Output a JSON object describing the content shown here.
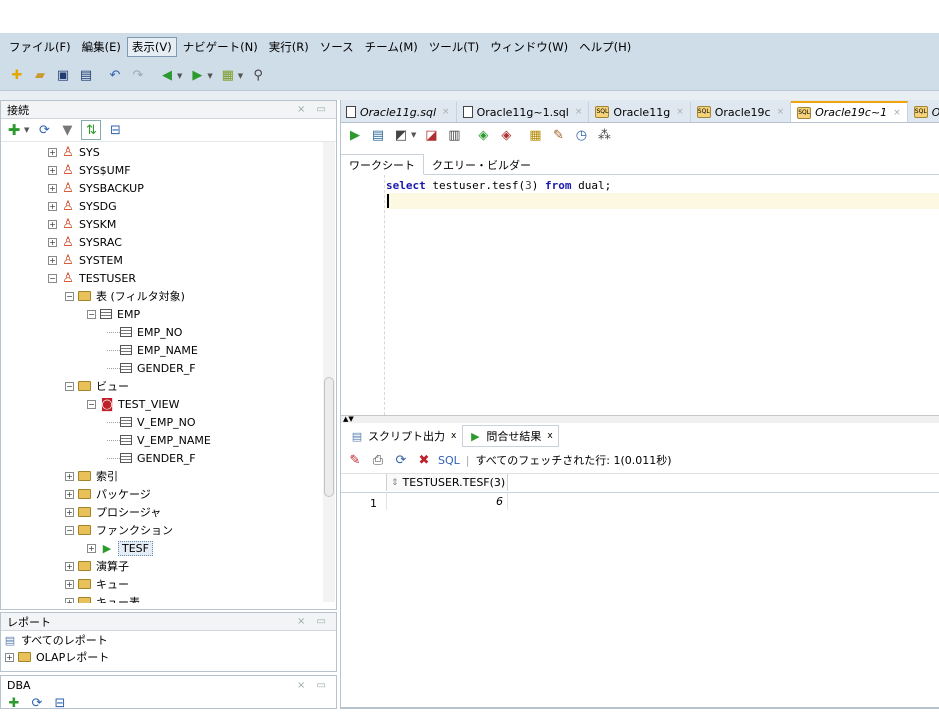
{
  "menu": [
    "ファイル(F)",
    "編集(E)",
    "表示(V)",
    "ナビゲート(N)",
    "実行(R)",
    "ソース",
    "チーム(M)",
    "ツール(T)",
    "ウィンドウ(W)",
    "ヘルプ(H)"
  ],
  "menu_active_index": 2,
  "connections": {
    "title": "接続",
    "tree": [
      {
        "label": "SYS",
        "type": "user",
        "level": 0,
        "expanded": false
      },
      {
        "label": "SYS$UMF",
        "type": "user",
        "level": 0,
        "expanded": false
      },
      {
        "label": "SYSBACKUP",
        "type": "user",
        "level": 0,
        "expanded": false
      },
      {
        "label": "SYSDG",
        "type": "user",
        "level": 0,
        "expanded": false
      },
      {
        "label": "SYSKM",
        "type": "user",
        "level": 0,
        "expanded": false
      },
      {
        "label": "SYSRAC",
        "type": "user",
        "level": 0,
        "expanded": false
      },
      {
        "label": "SYSTEM",
        "type": "user",
        "level": 0,
        "expanded": false
      },
      {
        "label": "TESTUSER",
        "type": "user",
        "level": 0,
        "expanded": true
      },
      {
        "label": "表 (フィルタ対象)",
        "type": "folder",
        "level": 1,
        "expanded": true
      },
      {
        "label": "EMP",
        "type": "table",
        "level": 2,
        "expanded": true
      },
      {
        "label": "EMP_NO",
        "type": "column",
        "level": 3
      },
      {
        "label": "EMP_NAME",
        "type": "column",
        "level": 3
      },
      {
        "label": "GENDER_F",
        "type": "column",
        "level": 3
      },
      {
        "label": "ビュー",
        "type": "folder",
        "level": 1,
        "expanded": true
      },
      {
        "label": "TEST_VIEW",
        "type": "view",
        "level": 2,
        "expanded": true
      },
      {
        "label": "V_EMP_NO",
        "type": "column",
        "level": 3
      },
      {
        "label": "V_EMP_NAME",
        "type": "column",
        "level": 3
      },
      {
        "label": "GENDER_F",
        "type": "column",
        "level": 3
      },
      {
        "label": "索引",
        "type": "folder",
        "level": 1,
        "expanded": false
      },
      {
        "label": "パッケージ",
        "type": "folder",
        "level": 1,
        "expanded": false
      },
      {
        "label": "プロシージャ",
        "type": "folder",
        "level": 1,
        "expanded": false
      },
      {
        "label": "ファンクション",
        "type": "folder",
        "level": 1,
        "expanded": true
      },
      {
        "label": "TESF",
        "type": "function",
        "level": 2,
        "expanded": false,
        "selected": true
      },
      {
        "label": "演算子",
        "type": "folder",
        "level": 1,
        "expanded": false
      },
      {
        "label": "キュー",
        "type": "folder",
        "level": 1,
        "expanded": false
      },
      {
        "label": "キュー表",
        "type": "folder",
        "level": 1,
        "expanded": false
      }
    ]
  },
  "reports": {
    "title": "レポート",
    "items": [
      "すべてのレポート",
      "OLAPレポート"
    ]
  },
  "dba": {
    "title": "DBA"
  },
  "editor_tabs": [
    {
      "label": "Oracle11g.sql",
      "icon": "file-icon",
      "italic": true,
      "active": false
    },
    {
      "label": "Oracle11g~1.sql",
      "icon": "file-icon",
      "italic": false,
      "active": false
    },
    {
      "label": "Oracle11g",
      "icon": "sql-icon",
      "italic": false,
      "active": false
    },
    {
      "label": "Oracle19c",
      "icon": "sql-icon",
      "italic": false,
      "active": false
    },
    {
      "label": "Oracle19c~1",
      "icon": "sql-icon",
      "italic": true,
      "active": true
    },
    {
      "label": "Oracle",
      "icon": "sql-icon",
      "italic": true,
      "active": false
    }
  ],
  "sub_tabs": [
    "ワークシート",
    "クエリー・ビルダー"
  ],
  "code": {
    "kw1": "select",
    "mid": " testuser.tesf(",
    "num": "3",
    "mid2": ") ",
    "kw2": "from",
    "tail": " dual;"
  },
  "output": {
    "tabs": [
      {
        "label": "スクリプト出力",
        "active": false
      },
      {
        "label": "問合せ結果",
        "active": true
      }
    ],
    "tab_close": "x",
    "sql_label": "SQL",
    "status": "すべてのフェッチされた行: 1(0.011秒)",
    "column": "TESTUSER.TESF(3)",
    "row_number": "1",
    "row_value": "6"
  }
}
